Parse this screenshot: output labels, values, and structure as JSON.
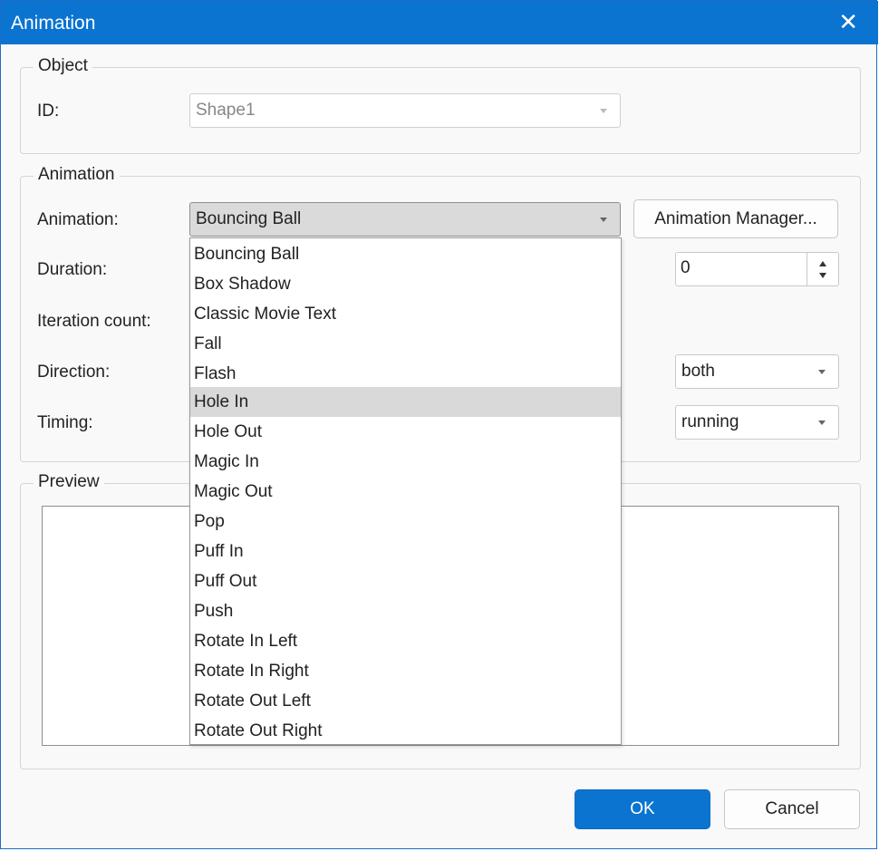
{
  "window": {
    "title": "Animation",
    "close_icon": "close-icon"
  },
  "object_group": {
    "legend": "Object",
    "id_label": "ID:",
    "id_value": "Shape1"
  },
  "animation_group": {
    "legend": "Animation",
    "animation_label": "Animation:",
    "animation_value": "Bouncing Ball",
    "manager_button": "Animation Manager...",
    "duration_label": "Duration:",
    "iteration_label": "Iteration count:",
    "direction_label": "Direction:",
    "timing_label": "Timing:",
    "delay_value": "0",
    "fill_mode_value": "both",
    "play_state_value": "running"
  },
  "preview_group": {
    "legend": "Preview"
  },
  "dropdown": {
    "options": [
      "Bouncing Ball",
      "Box Shadow",
      "Classic Movie Text",
      "Fall",
      "Flash",
      "Hole In",
      "Hole Out",
      "Magic In",
      "Magic Out",
      "Pop",
      "Puff In",
      "Puff Out",
      "Push",
      "Rotate In Left",
      "Rotate In Right",
      "Rotate Out Left",
      "Rotate Out Right"
    ],
    "highlighted": "Hole In"
  },
  "footer": {
    "ok": "OK",
    "cancel": "Cancel"
  },
  "colors": {
    "accent": "#0a74d0",
    "highlight": "#d9d9d9"
  }
}
